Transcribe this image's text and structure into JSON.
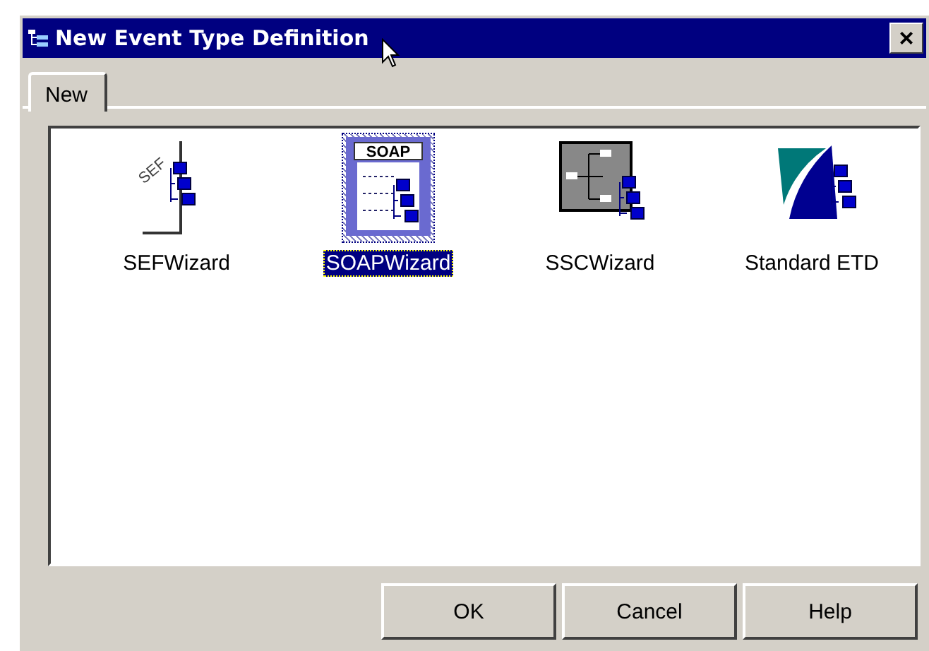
{
  "window": {
    "title": "New Event Type Definition",
    "close": "×"
  },
  "tabs": [
    {
      "label": "New",
      "selected": true
    }
  ],
  "items": [
    {
      "label": "SEFWizard",
      "kind": "sef",
      "icon_text": "SEF",
      "selected": false
    },
    {
      "label": "SOAPWizard",
      "kind": "soap",
      "icon_text": "SOAP",
      "selected": true
    },
    {
      "label": "SSCWizard",
      "kind": "ssc",
      "selected": false
    },
    {
      "label": "Standard ETD",
      "kind": "std",
      "selected": false
    }
  ],
  "buttons": [
    "OK",
    "Cancel",
    "Help"
  ]
}
